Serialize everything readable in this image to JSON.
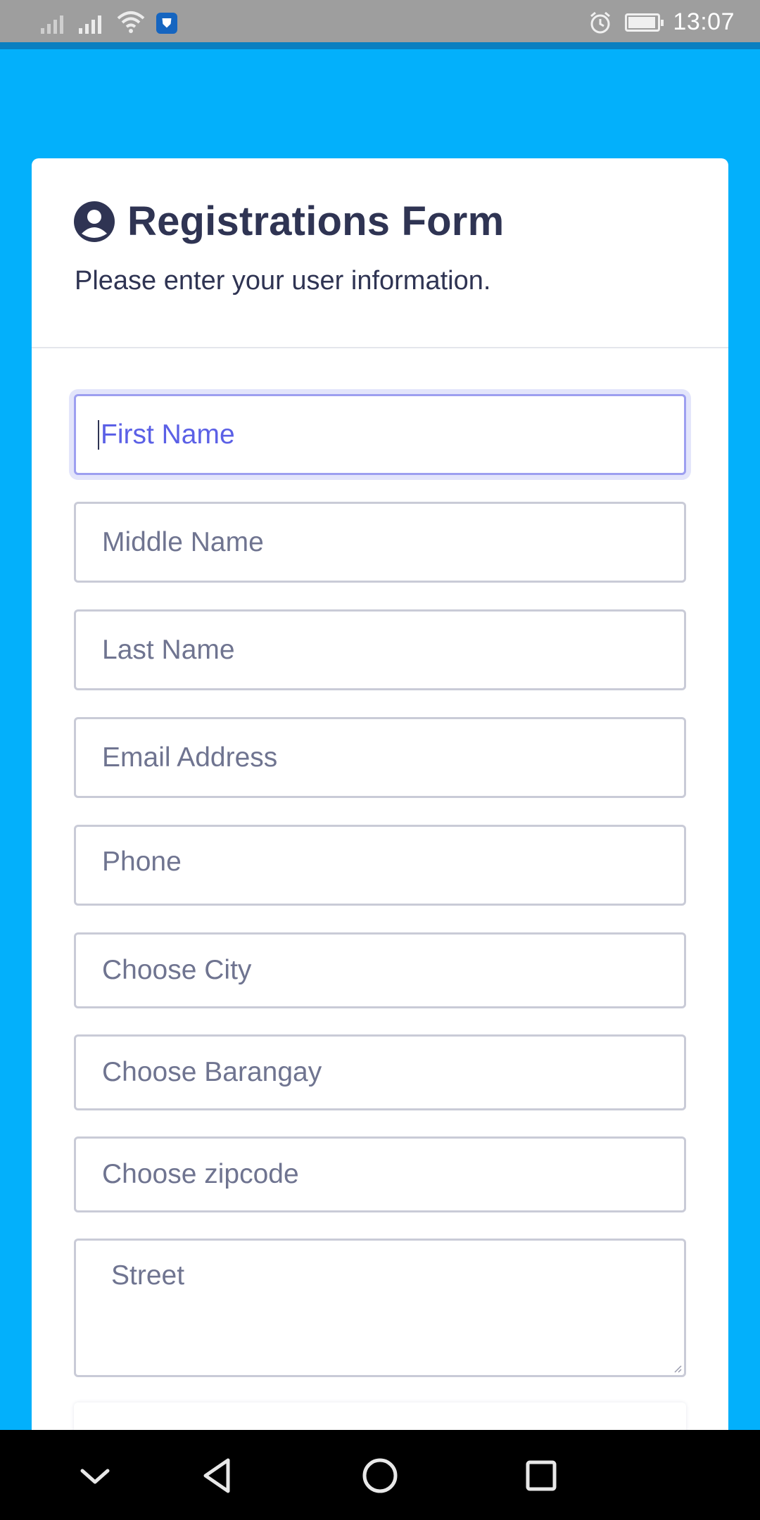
{
  "status_bar": {
    "time": "13:07",
    "icons": [
      "signal-icon",
      "signal-icon",
      "wifi-icon",
      "shield-app-icon",
      "alarm-icon",
      "battery-icon"
    ],
    "battery_level": 0.85
  },
  "colors": {
    "background": "#03b0fb",
    "title_text": "#2f3453",
    "focus_accent": "#5b60e6",
    "input_border": "#c9cbd7"
  },
  "form": {
    "title": "Registrations Form",
    "title_icon": "user-circle-icon",
    "subtitle": "Please enter your user information.",
    "fields": {
      "first_name": {
        "placeholder": "First Name",
        "focused": true
      },
      "middle_name": {
        "placeholder": "Middle Name"
      },
      "last_name": {
        "placeholder": "Last Name"
      },
      "email": {
        "placeholder": "Email Address"
      },
      "phone": {
        "placeholder": "Phone"
      },
      "city": {
        "placeholder": "Choose City"
      },
      "barangay": {
        "placeholder": "Choose Barangay"
      },
      "zipcode": {
        "placeholder": "Choose zipcode"
      },
      "street": {
        "placeholder": "Street"
      }
    }
  },
  "nav_bar": {
    "buttons": [
      "collapse-chevron-icon",
      "back-icon",
      "home-icon",
      "recents-icon"
    ]
  }
}
